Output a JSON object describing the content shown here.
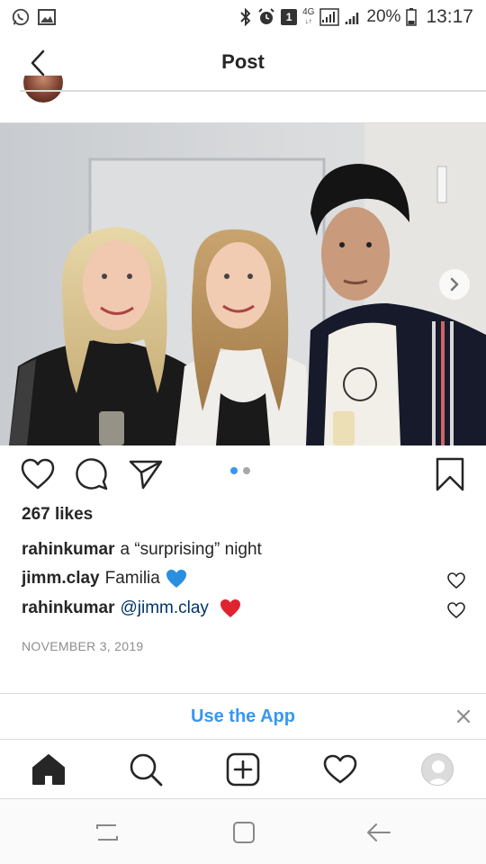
{
  "status_bar": {
    "battery_percent": "20%",
    "time": "13:17",
    "notification_count": "1",
    "network": "4G",
    "icons": [
      "whatsapp-icon",
      "gallery-icon",
      "bluetooth-icon",
      "alarm-icon",
      "signal-icon",
      "battery-icon"
    ]
  },
  "header": {
    "title": "Post",
    "back_icon": "chevron-left-icon"
  },
  "post": {
    "photo_alt": "Three friends posing",
    "carousel": {
      "count": 2,
      "active_index": 0
    },
    "likes": "267 likes",
    "caption": {
      "user": "rahinkumar",
      "text": "a “surprising” night"
    },
    "comments": [
      {
        "user": "jimm.clay",
        "text": "Familia",
        "emoji": "blue-heart"
      },
      {
        "user": "rahinkumar",
        "mention": "@jimm.clay",
        "emoji": "red-heart"
      }
    ],
    "date": "NOVEMBER 3, 2019"
  },
  "banner": {
    "label": "Use the App",
    "close_icon": "close-icon"
  },
  "bottom_nav": {
    "items": [
      "home-icon",
      "search-icon",
      "add-post-icon",
      "activity-heart-icon",
      "profile-avatar"
    ]
  },
  "colors": {
    "accent": "#3897f0",
    "text": "#262626",
    "secondary": "#8e8e8e",
    "mention": "#003569",
    "divider": "#dbdbdb"
  }
}
